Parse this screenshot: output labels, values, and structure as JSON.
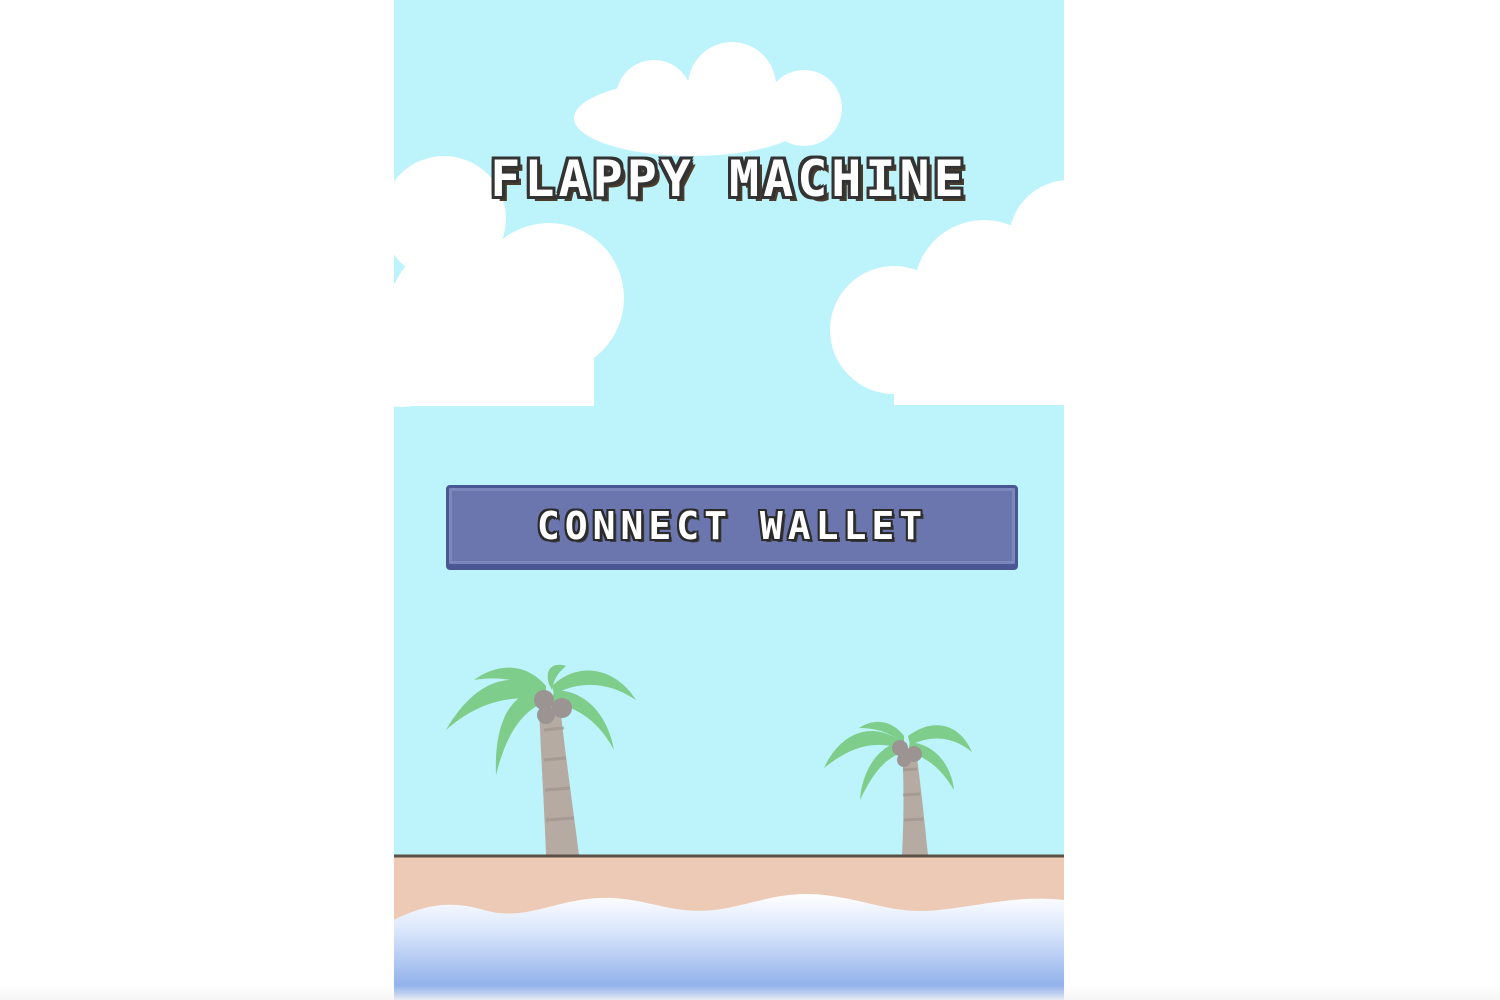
{
  "game": {
    "title": "FLAPPY MACHINE",
    "connect_button_label": "CONNECT WALLET"
  },
  "colors": {
    "sky": "#bdf3fb",
    "cloud": "#ffffff",
    "sand": "#edcab5",
    "shoreline": "#5a5046",
    "water": "#86a9e8",
    "foam": "#ffffff",
    "palm_leaves": "#7fcd8a",
    "palm_trunk": "#b6aba3",
    "coconut": "#9c9393",
    "button_fill": "#6a76ad",
    "button_border": "#4a5792",
    "text_fill": "#ffffff",
    "text_outline": "#333333"
  },
  "icons": [
    "cloud-icon",
    "palm-tree-icon"
  ]
}
